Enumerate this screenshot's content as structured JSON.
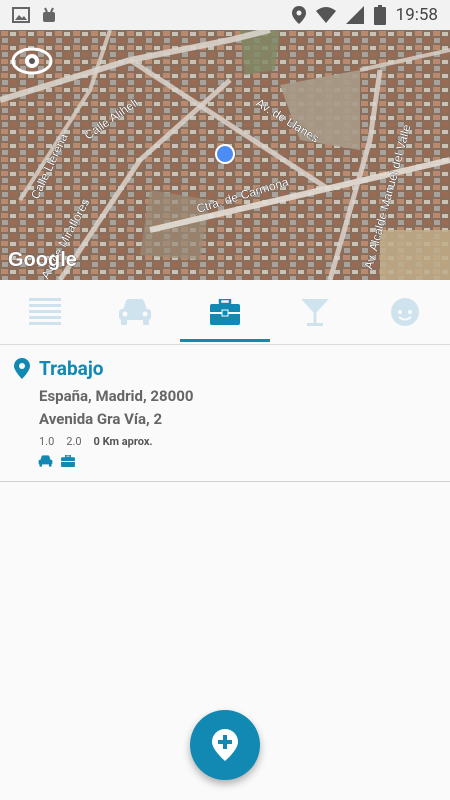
{
  "status_bar": {
    "time": "19:58"
  },
  "map": {
    "watermark": "Google",
    "street_labels": [
      "Calle Llerena",
      "Calle Aliheli",
      "Av. de Llanes",
      "Ctra. de Carmona",
      "Av. de Miraflores",
      "Av. Alcalde Manuel del Valle"
    ]
  },
  "tabs": [
    {
      "icon": "list-icon",
      "active": false
    },
    {
      "icon": "car-icon",
      "active": false
    },
    {
      "icon": "briefcase-icon",
      "active": true
    },
    {
      "icon": "cocktail-icon",
      "active": false
    },
    {
      "icon": "face-icon",
      "active": false
    }
  ],
  "location_card": {
    "title": "Trabajo",
    "address_line1": "España, Madrid, 28000",
    "address_line2": "Avenida Gra Vía, 2",
    "value1": "1.0",
    "value2": "2.0",
    "distance": "0 Km aprox."
  },
  "colors": {
    "accent": "#1189b3",
    "inactive_icon": "#cfe3ee"
  }
}
